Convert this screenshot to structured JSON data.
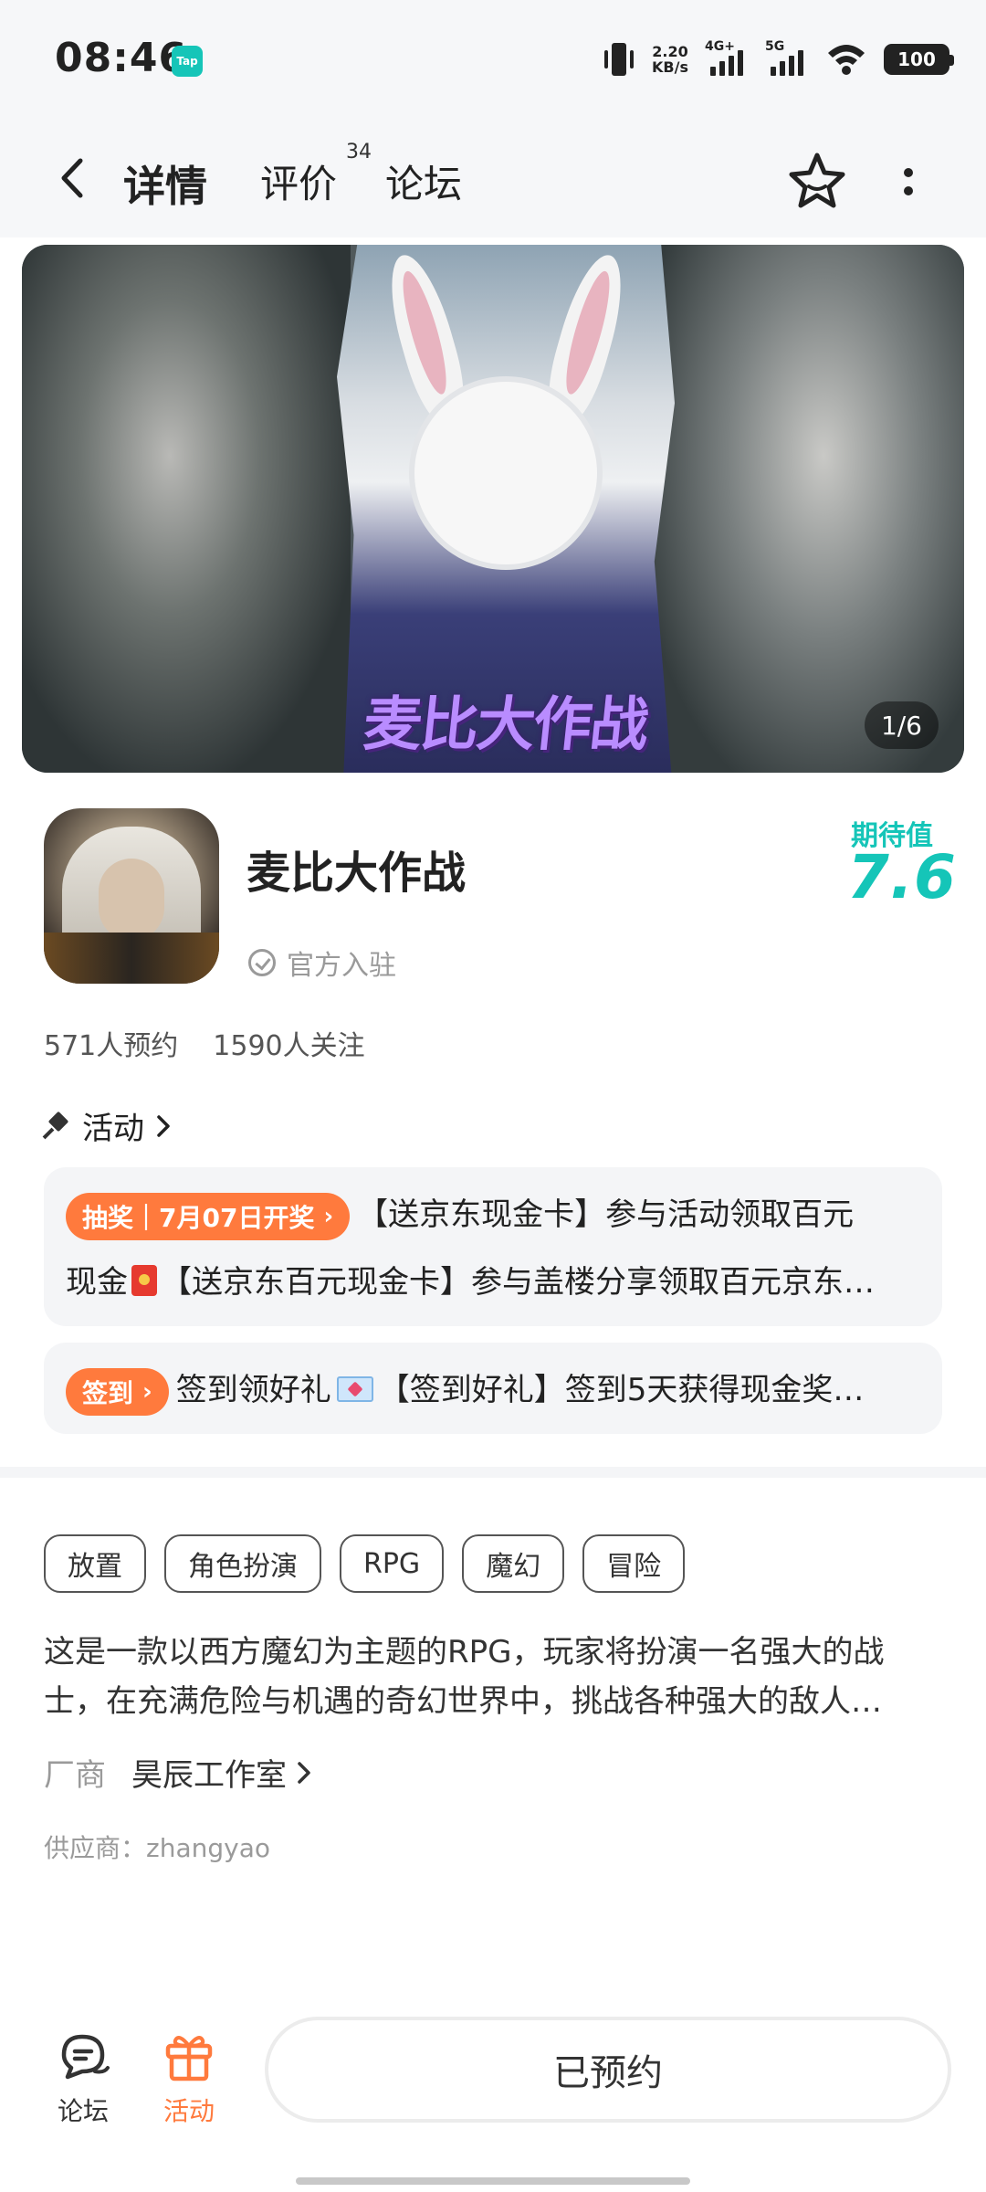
{
  "status_bar": {
    "time": "08:46",
    "app_badge": "Tap",
    "net_speed_value": "2.20",
    "net_speed_unit": "KB/s",
    "signal1_label": "4G+",
    "signal2_label": "5G",
    "battery": "100"
  },
  "nav": {
    "tab_detail": "详情",
    "tab_review": "评价",
    "review_count": "34",
    "tab_forum": "论坛"
  },
  "banner": {
    "logo_text": "麦比大作战",
    "pager": "1/6"
  },
  "game": {
    "title": "麦比大作战",
    "verified": "官方入驻",
    "score_label": "期待值",
    "score": "7.6",
    "reservations": "571人预约",
    "followers": "1590人关注"
  },
  "activity": {
    "header": "活动",
    "card1": {
      "badge": "抽奖｜7月07日开奖",
      "line1": "【送京东现金卡】参与活动领取百元",
      "line2_prefix": "现金",
      "line2_rest": "【送京东百元现金卡】参与盖楼分享领取百元京东…"
    },
    "card2": {
      "badge": "签到",
      "text_prefix": "签到领好礼",
      "text_rest": "【签到好礼】签到5天获得现金奖…"
    }
  },
  "tags": [
    "放置",
    "角色扮演",
    "RPG",
    "魔幻",
    "冒险"
  ],
  "description": {
    "line1": "这是一款以西方魔幻为主题的RPG，玩家将扮演一名强大的战",
    "line2": "士，在充满危险与机遇的奇幻世界中，挑战各种强大的敌人…"
  },
  "vendor": {
    "label": "厂商",
    "name": "昊辰工作室"
  },
  "supplier": "供应商：zhangyao",
  "bottom": {
    "forum_label": "论坛",
    "activity_label": "活动",
    "reserve_label": "已预约"
  },
  "colors": {
    "accent": "#15c5b8",
    "orange": "#ff7a3d",
    "card_bg": "#f4f5f7"
  }
}
